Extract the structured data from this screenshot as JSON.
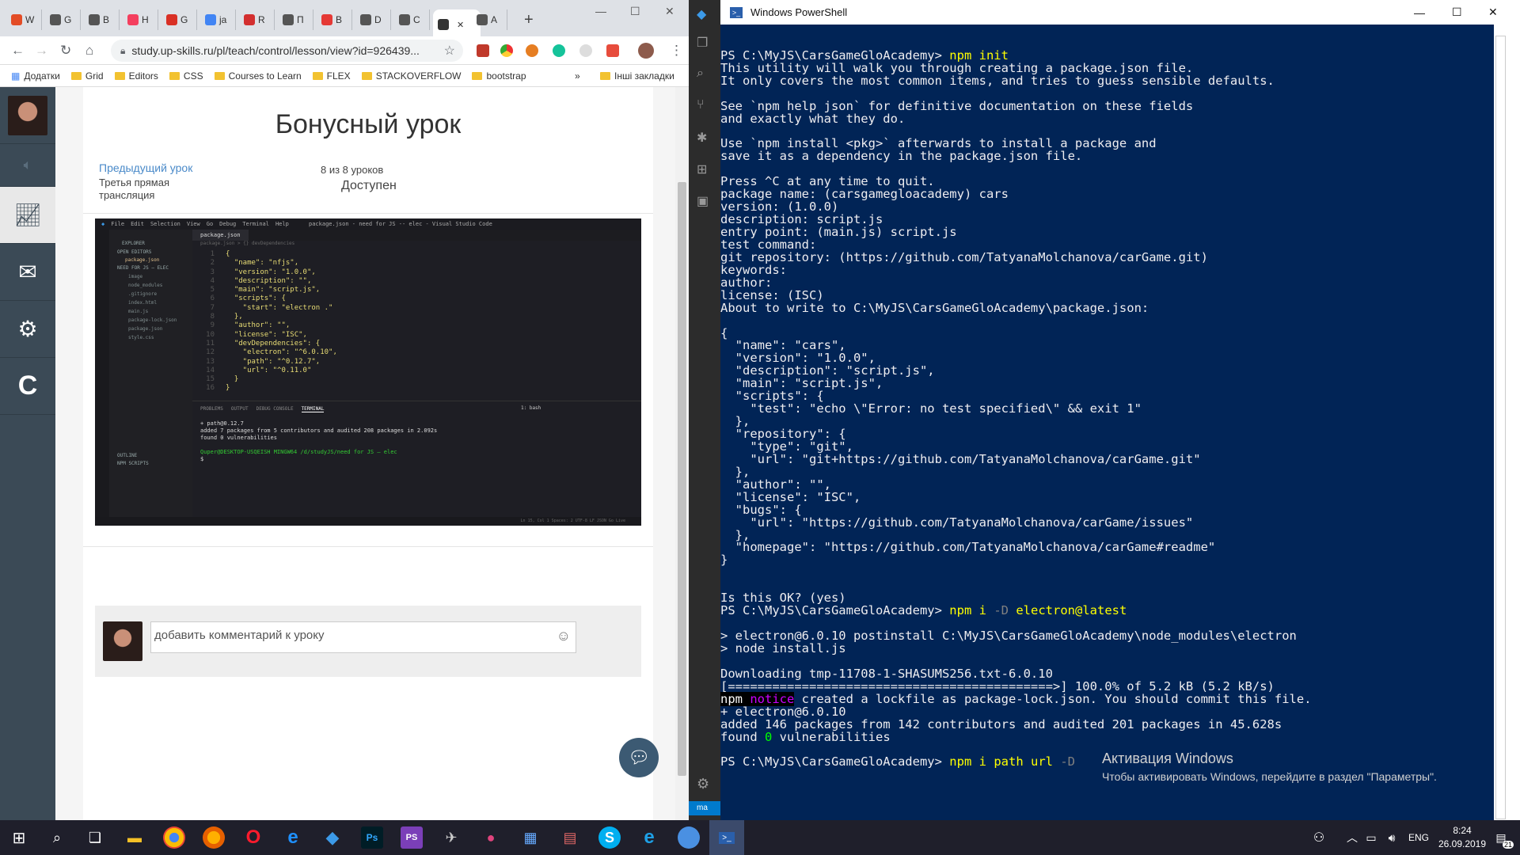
{
  "browser": {
    "tabs": [
      {
        "label": "W",
        "color": "#e34c26"
      },
      {
        "label": "G",
        "color": "#555"
      },
      {
        "label": "B",
        "color": "#555"
      },
      {
        "label": "Н",
        "color": "#f43f5e"
      },
      {
        "label": "G",
        "color": "#d93025"
      },
      {
        "label": "ja",
        "color": "#4285f4"
      },
      {
        "label": "R",
        "color": "#d32f2f"
      },
      {
        "label": "П",
        "color": "#555"
      },
      {
        "label": "В",
        "color": "#e53935"
      },
      {
        "label": "D",
        "color": "#555"
      },
      {
        "label": "C",
        "color": "#555"
      },
      {
        "label": "",
        "color": "#333"
      },
      {
        "label": "A",
        "color": "#555"
      }
    ],
    "url": "study.up-skills.ru/pl/teach/control/lesson/view?id=926439...",
    "bookmarks": [
      {
        "label": "Додатки",
        "type": "apps"
      },
      {
        "label": "Grid",
        "type": "folder"
      },
      {
        "label": "Editors",
        "type": "folder"
      },
      {
        "label": "CSS",
        "type": "folder"
      },
      {
        "label": "Courses to Learn",
        "type": "folder"
      },
      {
        "label": "FLEX",
        "type": "folder"
      },
      {
        "label": "STACKOVERFLOW",
        "type": "folder"
      },
      {
        "label": "bootstrap",
        "type": "folder"
      }
    ],
    "more_bookmarks": "»",
    "other_bookmarks": "Інші закладки"
  },
  "lesson": {
    "title": "Бонусный урок",
    "prev_link": "Предыдущий урок",
    "prev_title": "Третья прямая трансляция",
    "count": "8 из 8 уроков",
    "status": "Доступен",
    "comment_placeholder": "добавить комментарий к уроку"
  },
  "vscode_screenshot": {
    "menu": [
      "File",
      "Edit",
      "Selection",
      "View",
      "Go",
      "Debug",
      "Terminal",
      "Help"
    ],
    "window_title": "package.json - need for JS -- elec - Visual Studio Code",
    "tab": "package.json",
    "breadcrumb": "package.json > {} devDependencies",
    "explorer_title": "EXPLORER",
    "open_editors": "OPEN EDITORS",
    "open_file": "package.json",
    "project": "NEED FOR JS — ELEC",
    "files": [
      "image",
      "node_modules",
      ".gitignore",
      "index.html",
      "main.js",
      "package-lock.json",
      "package.json",
      "style.css"
    ],
    "code_lines": [
      "{",
      "  \"name\": \"nfjs\",",
      "  \"version\": \"1.0.0\",",
      "  \"description\": \"\",",
      "  \"main\": \"script.js\",",
      "  \"scripts\": {",
      "    \"start\": \"electron .\"",
      "  },",
      "  \"author\": \"\",",
      "  \"license\": \"ISC\",",
      "  \"devDependencies\": {",
      "    \"electron\": \"^6.0.10\",",
      "    \"path\": \"^0.12.7\",",
      "    \"url\": \"^0.11.0\"",
      "  }",
      "}"
    ],
    "panel_tabs": [
      "PROBLEMS",
      "OUTPUT",
      "DEBUG CONSOLE",
      "TERMINAL"
    ],
    "terminal_select": "1: bash",
    "terminal_lines": [
      "+ path@0.12.7",
      "added 7 packages from 5 contributors and audited 208 packages in 2.092s",
      "found 0 vulnerabilities",
      "",
      "Quper@DESKTOP-USQEISH MINGW64 /d/studyJS/need for JS — elec",
      "$ "
    ],
    "outline": "OUTLINE",
    "npm_scripts": "NPM SCRIPTS",
    "status_right": "Ln 15, Col 1   Spaces: 2   UTF-8   LF   JSON   Go Live"
  },
  "powershell": {
    "title": "Windows PowerShell",
    "lines": [
      "PS C:\\MyJS\\CarsGameGloAcademy> npm init",
      "This utility will walk you through creating a package.json file.",
      "It only covers the most common items, and tries to guess sensible defaults.",
      "",
      "See `npm help json` for definitive documentation on these fields",
      "and exactly what they do.",
      "",
      "Use `npm install <pkg>` afterwards to install a package and",
      "save it as a dependency in the package.json file.",
      "",
      "Press ^C at any time to quit.",
      "package name: (carsgamegloacademy) cars",
      "version: (1.0.0)",
      "description: script.js",
      "entry point: (main.js) script.js",
      "test command:",
      "git repository: (https://github.com/TatyanaMolchanova/carGame.git)",
      "keywords:",
      "author:",
      "license: (ISC)",
      "About to write to C:\\MyJS\\CarsGameGloAcademy\\package.json:",
      "",
      "{",
      "  \"name\": \"cars\",",
      "  \"version\": \"1.0.0\",",
      "  \"description\": \"script.js\",",
      "  \"main\": \"script.js\",",
      "  \"scripts\": {",
      "    \"test\": \"echo \\\"Error: no test specified\\\" && exit 1\"",
      "  },",
      "  \"repository\": {",
      "    \"type\": \"git\",",
      "    \"url\": \"git+https://github.com/TatyanaMolchanova/carGame.git\"",
      "  },",
      "  \"author\": \"\",",
      "  \"license\": \"ISC\",",
      "  \"bugs\": {",
      "    \"url\": \"https://github.com/TatyanaMolchanova/carGame/issues\"",
      "  },",
      "  \"homepage\": \"https://github.com/TatyanaMolchanova/carGame#readme\"",
      "}",
      "",
      "",
      "Is this OK? (yes)",
      "PS C:\\MyJS\\CarsGameGloAcademy> npm i -D electron@latest",
      "",
      "> electron@6.0.10 postinstall C:\\MyJS\\CarsGameGloAcademy\\node_modules\\electron",
      "> node install.js",
      "",
      "Downloading tmp-11708-1-SHASUMS256.txt-6.0.10",
      "[============================================>] 100.0% of 5.2 kB (5.2 kB/s)",
      "npm notice created a lockfile as package-lock.json. You should commit this file.",
      "+ electron@6.0.10",
      "added 146 packages from 142 contributors and audited 201 packages in 45.628s",
      "found 0 vulnerabilities",
      "",
      "PS C:\\MyJS\\CarsGameGloAcademy> npm i path url -D"
    ],
    "watermark_title": "Активация Windows",
    "watermark_sub": "Чтобы активировать Windows, перейдите в раздел \"Параметры\"."
  },
  "vscode_sidebar_label": "ma",
  "taskbar": {
    "lang": "ENG",
    "time": "8:24",
    "date": "26.09.2019",
    "notifications": "21"
  },
  "colors": {
    "ps_bg": "#012456",
    "ps_fg": "#eeedf0",
    "ps_cmd": "#ffff00",
    "ps_flag": "#808080",
    "link": "#4a8ac9",
    "rail": "#3b4a56"
  }
}
